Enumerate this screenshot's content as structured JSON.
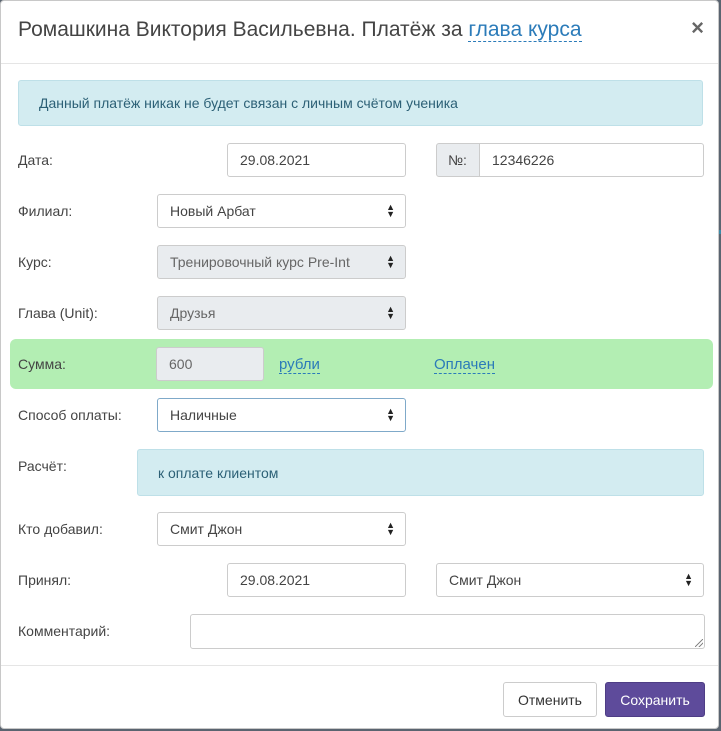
{
  "modal": {
    "title_prefix": "Ромашкина Виктория Васильевна. Платёж за",
    "title_link": "глава курса",
    "close_glyph": "×"
  },
  "alert": "Данный платёж никак не будет связан с личным счётом ученика",
  "fields": {
    "date": {
      "label": "Дата:",
      "value": "29.08.2021"
    },
    "number": {
      "addon": "№:",
      "value": "12346226"
    },
    "branch": {
      "label": "Филиал:",
      "value": "Новый Арбат"
    },
    "course": {
      "label": "Курс:",
      "value": "Тренировочный курс Pre-Int"
    },
    "unit": {
      "label": "Глава (Unit):",
      "value": "Друзья"
    },
    "sum": {
      "label": "Сумма:",
      "value": "600",
      "currency": "рубли",
      "status": "Оплачен"
    },
    "payment_method": {
      "label": "Способ оплаты:",
      "value": "Наличные"
    },
    "calculation": {
      "label": "Расчёт:",
      "value": "к оплате клиентом"
    },
    "added_by": {
      "label": "Кто добавил:",
      "value": "Смит Джон"
    },
    "received": {
      "label": "Принял:",
      "date": "29.08.2021",
      "person": "Смит Джон"
    },
    "comment": {
      "label": "Комментарий:",
      "value": ""
    }
  },
  "buttons": {
    "cancel": "Отменить",
    "save": "Сохранить"
  },
  "icons": {
    "select_arrow": "select-updown-icon"
  },
  "colors": {
    "accent_link": "#2b7bb9",
    "primary_button": "#5e4b9b",
    "paid_row": "#b3eeb3",
    "info_bg": "#d3ecf1"
  }
}
